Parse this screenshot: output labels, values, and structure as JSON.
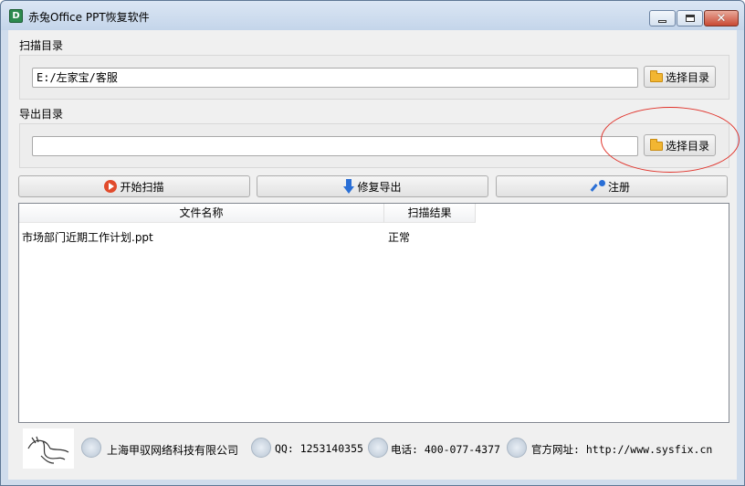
{
  "window": {
    "title": "赤兔Office PPT恢复软件",
    "close_glyph": "✕"
  },
  "scan": {
    "label": "扫描目录",
    "path_value": "E:/左家宝/客服",
    "browse_label": "选择目录"
  },
  "export": {
    "label": "导出目录",
    "path_value": "",
    "browse_label": "选择目录"
  },
  "actions": {
    "start_scan": "开始扫描",
    "repair_export": "修复导出",
    "register": "注册"
  },
  "table": {
    "columns": [
      "文件名称",
      "扫描结果"
    ],
    "rows": [
      {
        "name": "市场部门近期工作计划.ppt",
        "result": "正常"
      }
    ]
  },
  "footer": {
    "company": "上海甲驭网络科技有限公司",
    "qq": "QQ: 1253140355",
    "phone": "电话: 400-077-4377",
    "website": "官方网址: http://www.sysfix.cn"
  },
  "colors": {
    "annotation_circle": "#e0322a",
    "start_icon": "#e14b2c",
    "export_icon": "#2a6fd6",
    "folder_icon": "#f2b632"
  },
  "icons": {
    "app": "app-icon",
    "browse": "folder-icon",
    "start_scan": "play-icon",
    "repair_export": "arrow-down-icon",
    "register": "key-icon",
    "company": "building-icon",
    "qq": "qq-penguin-icon",
    "phone": "phone-icon",
    "website": "globe-icon"
  }
}
